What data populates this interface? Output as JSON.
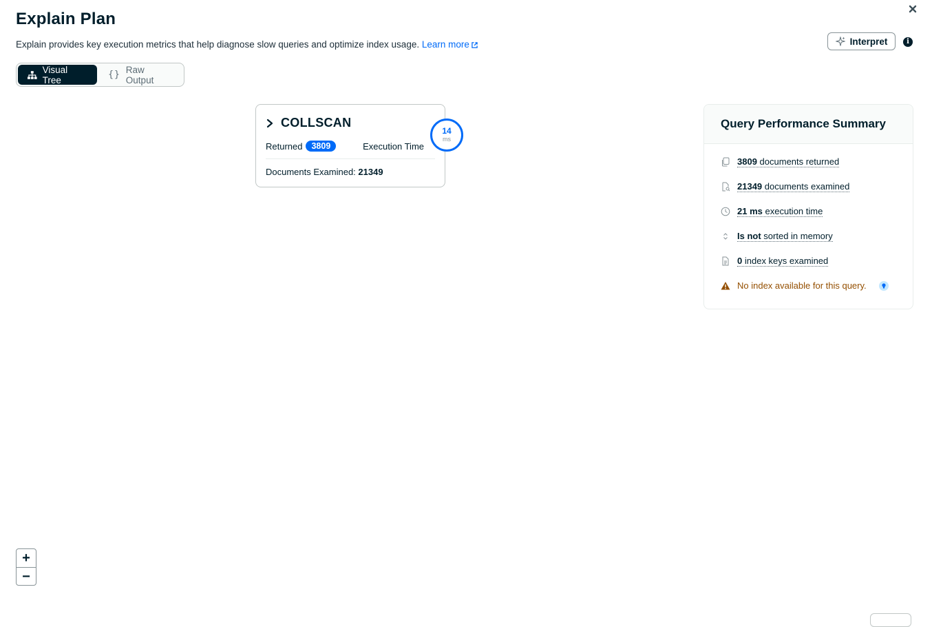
{
  "header": {
    "title": "Explain Plan",
    "description": "Explain provides key execution metrics that help diagnose slow queries and optimize index usage.",
    "learn_more": "Learn more",
    "interpret_label": "Interpret",
    "info_glyph": "i"
  },
  "view_toggle": {
    "options": [
      {
        "label": "Visual Tree",
        "icon": "tree-icon",
        "selected": true
      },
      {
        "label": "Raw Output",
        "icon": "braces-icon",
        "selected": false
      }
    ]
  },
  "stage": {
    "name": "COLLSCAN",
    "returned_label": "Returned",
    "returned_value": "3809",
    "execution_time_label": "Execution Time",
    "execution_time_value": "14",
    "execution_time_unit": "ms",
    "docs_examined_label": "Documents Examined:",
    "docs_examined_value": "21349"
  },
  "summary": {
    "title": "Query Performance Summary",
    "items": [
      {
        "icon": "copy-icon",
        "value": "3809",
        "text": "documents returned"
      },
      {
        "icon": "file-search-icon",
        "value": "21349",
        "text": "documents examined"
      },
      {
        "icon": "clock-icon",
        "value": "21 ms",
        "text": "execution time"
      },
      {
        "icon": "sort-icon",
        "value": "Is not",
        "text": "sorted in memory"
      },
      {
        "icon": "file-icon",
        "value": "0",
        "text": "index keys examined"
      }
    ],
    "warning": "No index available for this query.",
    "colors": {
      "warning": "#944f01",
      "accent": "#016bf8"
    }
  },
  "zoom": {
    "in": "+",
    "out": "−"
  }
}
